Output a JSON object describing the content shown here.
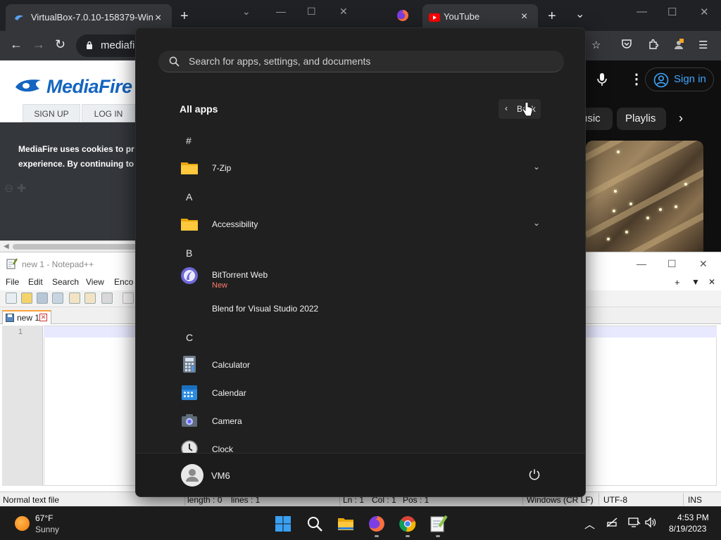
{
  "left_browser": {
    "tab_title": "VirtualBox-7.0.10-158379-Win",
    "address": "mediafi",
    "site": {
      "logo": "MediaFire",
      "sign_up": "SIGN UP",
      "log_in": "LOG IN",
      "cookie_line1": "MediaFire uses cookies to pr",
      "cookie_line2": "experience. By continuing to"
    }
  },
  "right_browser": {
    "tab_title": "YouTube",
    "sign_in": "Sign in",
    "chips": [
      "usic",
      "Playlis"
    ]
  },
  "notepad": {
    "title": "new 1 - Notepad++",
    "menus": [
      "File",
      "Edit",
      "Search",
      "View",
      "Enco"
    ],
    "tab": "new 1",
    "line_number": "1",
    "status": {
      "type": "Normal text file",
      "length": "length : 0",
      "lines": "lines : 1",
      "ln": "Ln : 1",
      "col": "Col : 1",
      "pos": "Pos : 1",
      "eol": "Windows (CR LF)",
      "encoding": "UTF-8",
      "mode": "INS"
    }
  },
  "start_menu": {
    "search_placeholder": "Search for apps, settings, and documents",
    "title": "All apps",
    "back": "Back",
    "groups": [
      {
        "letter": "#",
        "apps": [
          {
            "name": "7-Zip",
            "icon": "folder-icon",
            "expandable": true
          }
        ]
      },
      {
        "letter": "A",
        "apps": [
          {
            "name": "Accessibility",
            "icon": "folder-icon",
            "expandable": true
          }
        ]
      },
      {
        "letter": "B",
        "apps": [
          {
            "name": "BitTorrent Web",
            "badge": "New",
            "icon": "bittorrent-icon"
          },
          {
            "name": "Blend for Visual Studio 2022",
            "icon": ""
          }
        ]
      },
      {
        "letter": "C",
        "apps": [
          {
            "name": "Calculator",
            "icon": "calculator-icon"
          },
          {
            "name": "Calendar",
            "icon": "calendar-icon"
          },
          {
            "name": "Camera",
            "icon": "camera-icon"
          },
          {
            "name": "Clock",
            "icon": "clock-icon"
          }
        ]
      }
    ],
    "user": "VM6"
  },
  "taskbar": {
    "weather_temp": "67°F",
    "weather_cond": "Sunny",
    "apps": [
      "start-icon",
      "search-icon",
      "file-explorer-icon",
      "firefox-icon",
      "chrome-icon",
      "notepad-plus-plus-icon"
    ],
    "time": "4:53 PM",
    "date": "8/19/2023"
  },
  "colors": {
    "accent": "#0078d4",
    "start_bg": "#202020",
    "mediafire_blue": "#1565c0",
    "youtube_link": "#3ea6ff",
    "new_badge": "#ff7b6b"
  }
}
